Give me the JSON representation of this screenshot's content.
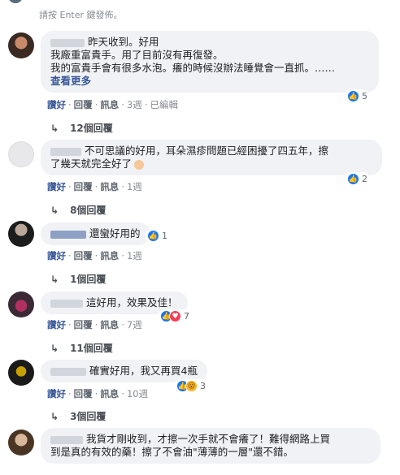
{
  "hint_text": "請按 Enter 鍵發佈。",
  "actions": {
    "like": "讚好",
    "reply": "回覆",
    "message": "訊息"
  },
  "comments": [
    {
      "lines": [
        "昨天收到。好用",
        "我廠重富貴手。用了目前沒有再復發。",
        "我的富貴手會有很多水泡。癢的時候沒辦法睡覺會一直抓。……"
      ],
      "see_more": "查看更多",
      "time": "3週",
      "edited": "已編輯",
      "reaction_count": "5",
      "replies": "12個回覆"
    },
    {
      "lines": [
        "不可思議的好用，耳朵濕疹問題已經困擾了四五年，擦",
        "了幾天就完全好了"
      ],
      "time": "1週",
      "reaction_count": "2",
      "replies": "8個回覆"
    },
    {
      "lines": [
        "還蠻好用的"
      ],
      "time": "1週",
      "reaction_count": "1",
      "replies": "1個回覆"
    },
    {
      "lines": [
        "這好用，效果及佳！"
      ],
      "time": "7週",
      "reaction_count": "7",
      "replies": "11個回覆"
    },
    {
      "lines": [
        "確實好用，我又再買4瓶"
      ],
      "time": "10週",
      "reaction_count": "3",
      "replies": "3個回覆"
    },
    {
      "lines": [
        "我貨才剛收到，才擦一次手就不會癢了！難得網路上買",
        "到是真的有效的藥！擦了不會油\"薄薄的一層\"還不錯。"
      ]
    }
  ],
  "colors": {
    "link": "#385898",
    "bubble": "#f0f2f5",
    "like": "#1877f2",
    "love": "#f33e58"
  }
}
